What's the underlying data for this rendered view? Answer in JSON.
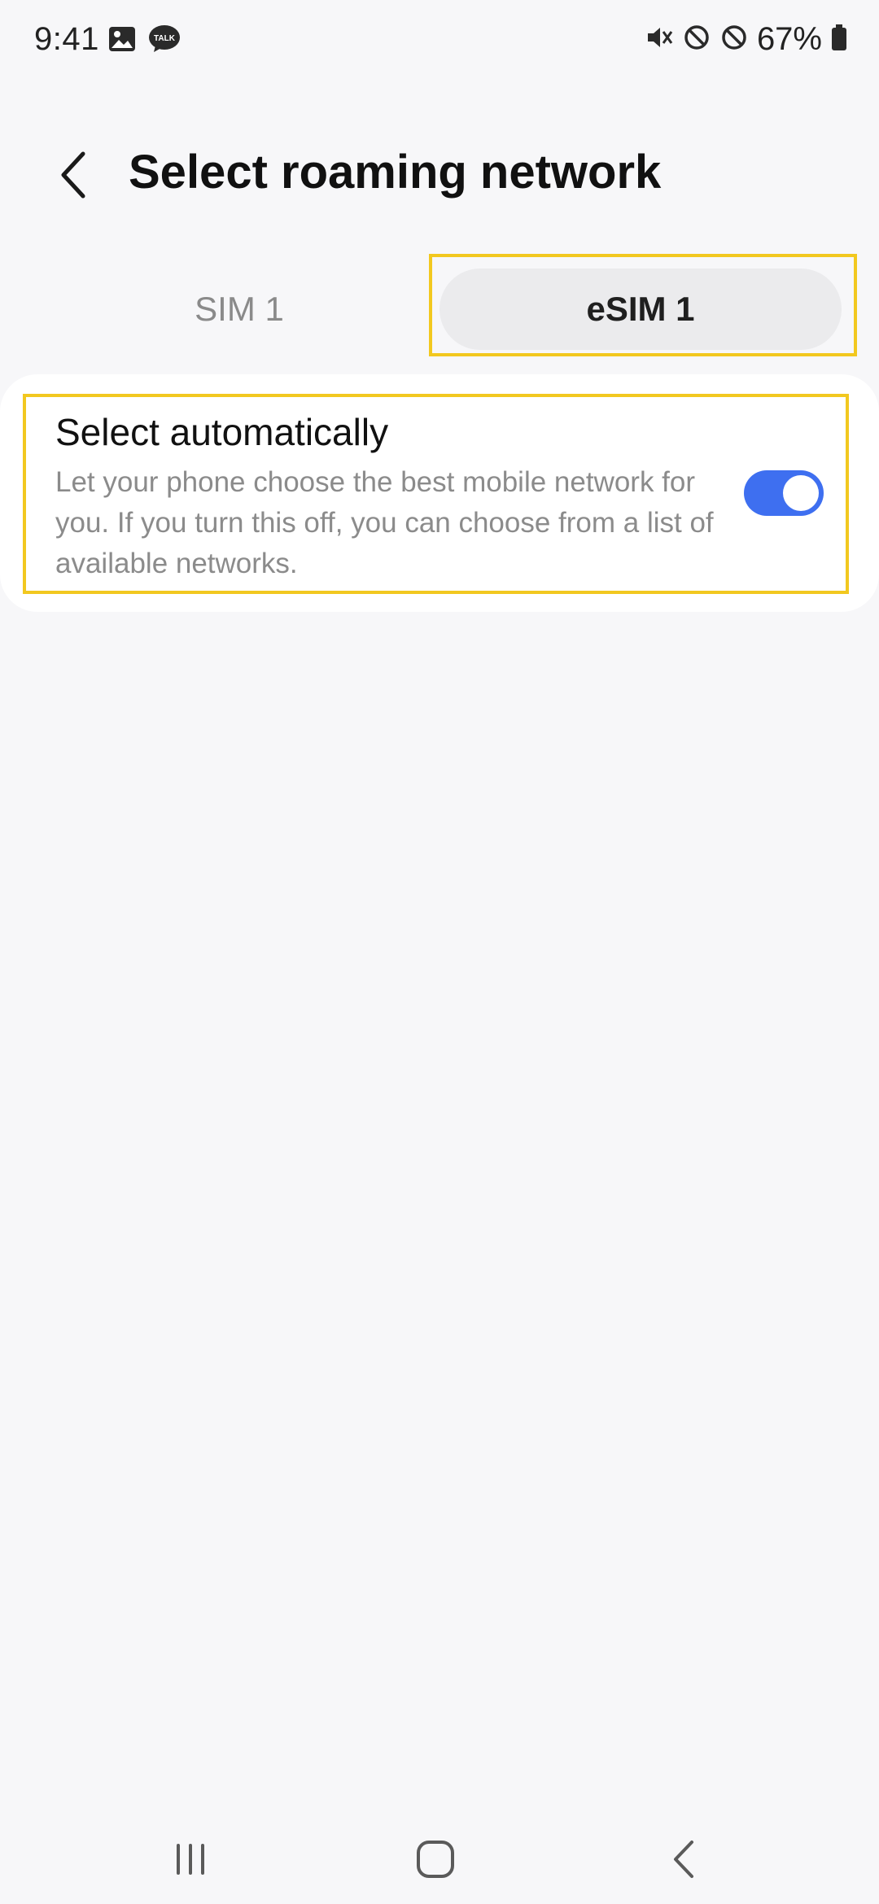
{
  "status_bar": {
    "time": "9:41",
    "battery": "67%",
    "icons_left": [
      "gallery-icon",
      "talk-icon"
    ],
    "icons_right": [
      "mute-icon",
      "blocked-icon",
      "blocked-icon",
      "battery-icon"
    ],
    "talk_badge": "TALK"
  },
  "header": {
    "back_icon": "chevron-left-icon",
    "title": "Select roaming network"
  },
  "tabs": [
    {
      "label": "SIM 1",
      "selected": false
    },
    {
      "label": "eSIM 1",
      "selected": true
    }
  ],
  "auto_select": {
    "title": "Select automatically",
    "description": "Let your phone choose the best mobile network for you. If you turn this off, you can choose from a list of available networks.",
    "enabled": true
  },
  "colors": {
    "background": "#f7f7f9",
    "accent": "#3e6ff0",
    "highlight": "#f2c81f",
    "secondary_text": "#8b8b8b"
  },
  "nav_bar": {
    "buttons": [
      "recent-apps-icon",
      "home-icon",
      "back-icon"
    ]
  }
}
